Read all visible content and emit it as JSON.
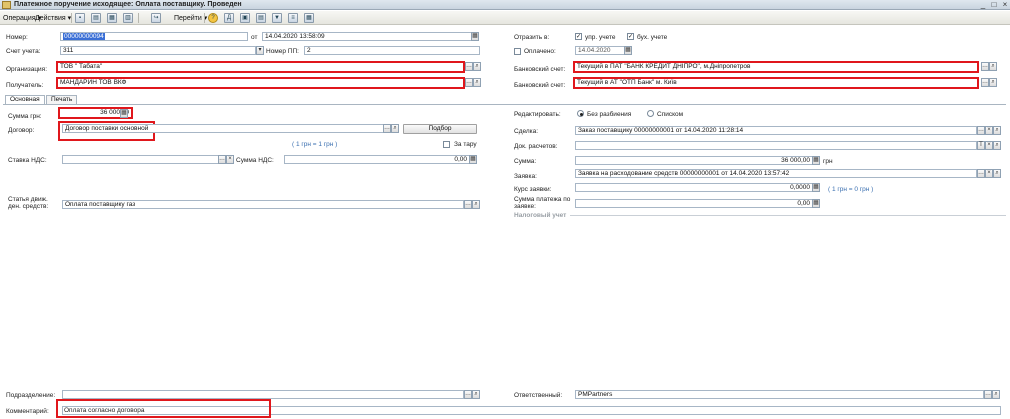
{
  "window": {
    "title": "Платежное поручение исходящее: Оплата поставщику. Проведен"
  },
  "toolbar": {
    "operation": "Операция",
    "actions": "Действия",
    "goto": "Перейти"
  },
  "header": {
    "number_label": "Номер:",
    "number": "00000000094",
    "from_label": "от",
    "date": "14.04.2020 13:58:09",
    "account_label": "Счет учета:",
    "account": "311",
    "pp_label": "Номер ПП:",
    "pp": "2",
    "org_label": "Организация:",
    "org": "ТОВ \" Табата\"",
    "recipient_label": "Получатель:",
    "recipient": "МАНДАРИН ТОВ ВКФ",
    "reflect_label": "Отразить в:",
    "upr": "упр. учете",
    "buh": "бух. учете",
    "paid_label": "Оплачено:",
    "paid_date": "14.04.2020",
    "bank1_label": "Банковский счет:",
    "bank1": "Текущий в ПАТ \"БАНК КРЕДИТ ДНІПРО\", м.Дніпропетров",
    "bank2_label": "Банковский счет:",
    "bank2": "Текущий в АТ \"ОТП Банк\" м. Київ"
  },
  "tabs": [
    "Основная",
    "Печать"
  ],
  "main": {
    "sum_label": "Сумма грн:",
    "sum": "36 000,00",
    "contract_label": "Договор:",
    "contract": "Договор поставки основной",
    "pick_btn": "Подбор",
    "tare": "За тару",
    "rate_link": "( 1 грн = 1 грн )",
    "vat_rate_label": "Ставка НДС:",
    "vat_sum_label": "Сумма НДС:",
    "vat_sum": "0,00",
    "cashflow_label": "Статья движ. ден. средств:",
    "cashflow": "Оплата поставщику газ"
  },
  "right": {
    "edit_label": "Редактировать:",
    "opt1": "Без разбиения",
    "opt2": "Списком",
    "deal_label": "Сделка:",
    "deal": "Заказ поставщику 00000000001 от 14.04.2020 11:28:14",
    "docsettle_label": "Док. расчетов:",
    "sum_label": "Сумма:",
    "sum": "36 000,00",
    "currency": "грн",
    "request_label": "Заявка:",
    "request": "Заявка на расходование средств 00000000001 от 14.04.2020 13:57:42",
    "rate_label": "Курс заявки:",
    "rate": "0,0000",
    "rate_link": "( 1 грн = 0 грн )",
    "paysum_label": "Сумма платежа по заявке:",
    "paysum": "0,00",
    "tax_label": "Налоговый учет"
  },
  "footer": {
    "division_label": "Подразделение:",
    "responsible_label": "Ответственный:",
    "responsible": "PMPartners",
    "comment_label": "Комментарий:",
    "comment": "Оплата согласно договора"
  }
}
